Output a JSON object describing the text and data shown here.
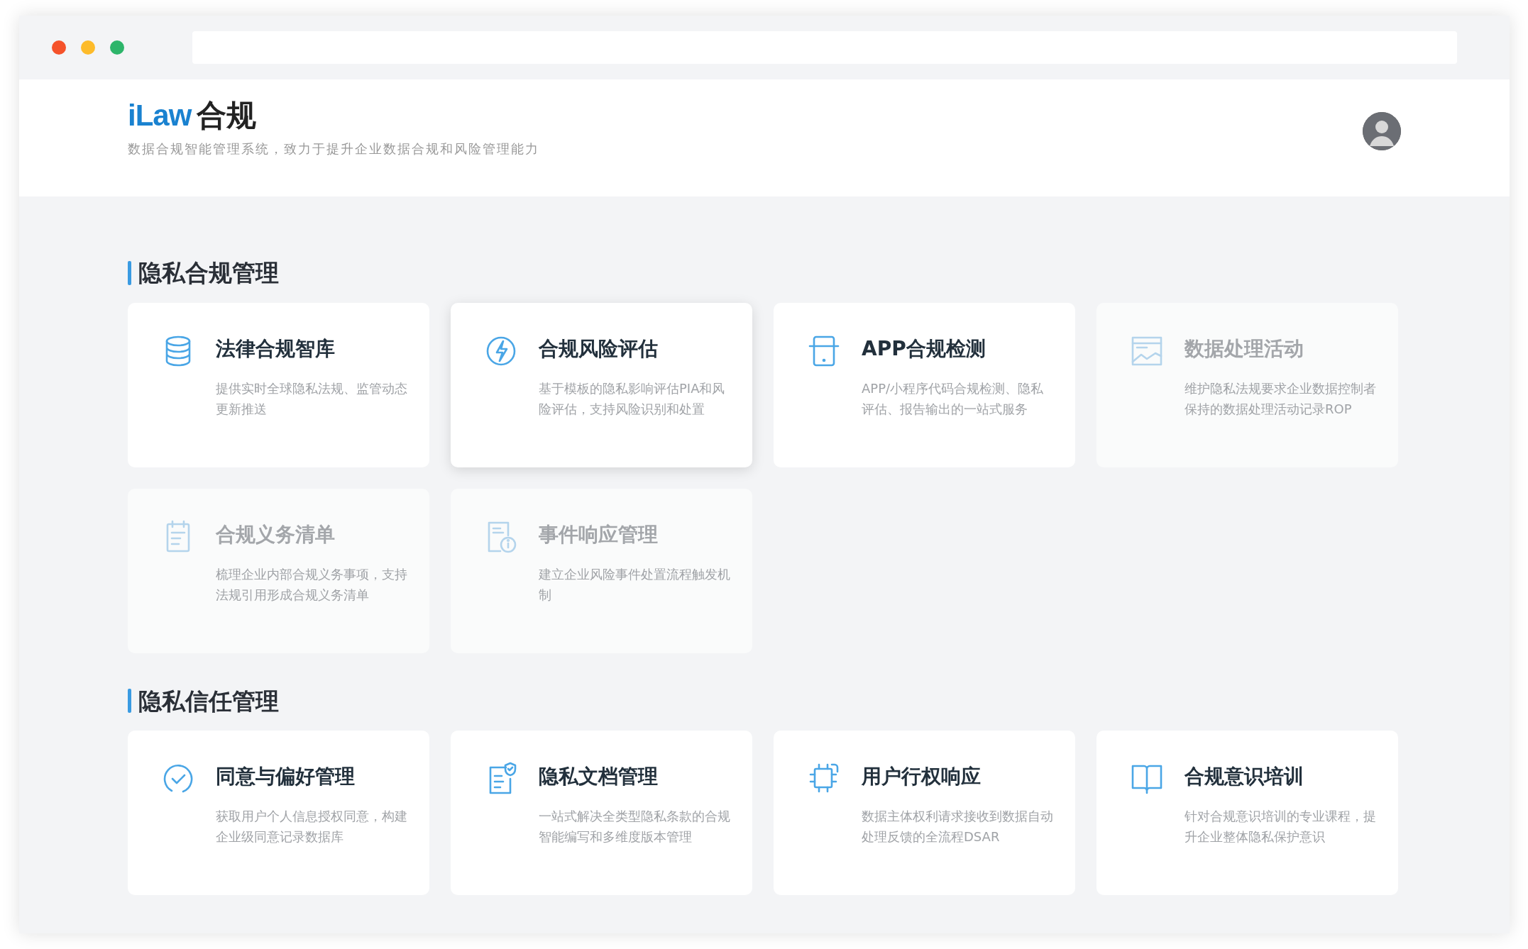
{
  "header": {
    "logo": {
      "brand": "iLaw",
      "product": "合规"
    },
    "tagline": "数据合规智能管理系统，致力于提升企业数据合规和风险管理能力"
  },
  "sections": [
    {
      "title": "隐私合规管理",
      "cards": [
        {
          "kind": "database",
          "title": "法律合规智库",
          "description": "提供实时全球隐私法规、监管动态更新推送",
          "disabled": false,
          "highlighted": false
        },
        {
          "kind": "lightning",
          "title": "合规风险评估",
          "description": "基于模板的隐私影响评估PIA和风险评估，支持风险识别和处置",
          "disabled": false,
          "highlighted": true
        },
        {
          "kind": "phone",
          "title": "APP合规检测",
          "description": "APP/小程序代码合规检测、隐私评估、报告输出的一站式服务",
          "disabled": false,
          "highlighted": false
        },
        {
          "kind": "chart",
          "title": "数据处理活动",
          "description": "维护隐私法规要求企业数据控制者保持的数据处理活动记录ROP",
          "disabled": true,
          "highlighted": false
        },
        {
          "kind": "notepad",
          "title": "合规义务清单",
          "description": "梳理企业内部合规义务事项，支持法规引用形成合规义务清单",
          "disabled": true,
          "highlighted": false
        },
        {
          "kind": "document-info",
          "title": "事件响应管理",
          "description": "建立企业风险事件处置流程触发机制",
          "disabled": true,
          "highlighted": false
        }
      ]
    },
    {
      "title": "隐私信任管理",
      "cards": [
        {
          "kind": "check",
          "title": "同意与偏好管理",
          "description": "获取用户个人信息授权同意，构建企业级同意记录数据库",
          "disabled": false,
          "highlighted": false
        },
        {
          "kind": "document-shield",
          "title": "隐私文档管理",
          "description": "一站式解决全类型隐私条款的合规智能编写和多维度版本管理",
          "disabled": false,
          "highlighted": false
        },
        {
          "kind": "chip",
          "title": "用户行权响应",
          "description": "数据主体权利请求接收到数据自动处理反馈的全流程DSAR",
          "disabled": false,
          "highlighted": false
        },
        {
          "kind": "book",
          "title": "合规意识培训",
          "description": "针对合规意识培训的专业课程，提升企业整体隐私保护意识",
          "disabled": false,
          "highlighted": false
        }
      ]
    }
  ]
}
